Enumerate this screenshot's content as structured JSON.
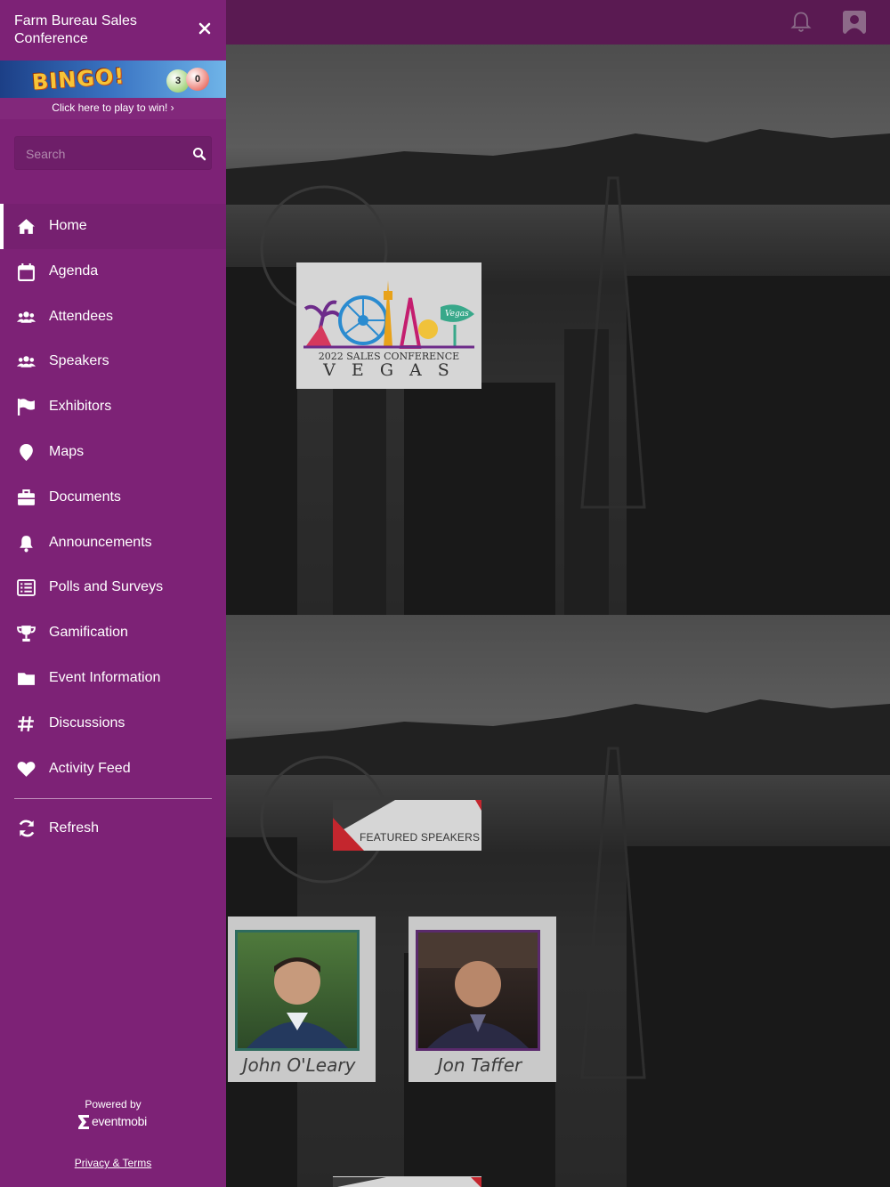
{
  "app": {
    "title": "Farm Bureau Sales Conference"
  },
  "banner": {
    "bingo_text": "BINGO!",
    "cta": "Click here to play to win! ›",
    "balls": [
      "3",
      "0"
    ]
  },
  "search": {
    "placeholder": "Search"
  },
  "nav": {
    "items": [
      {
        "label": "Home",
        "icon": "home-icon",
        "active": true
      },
      {
        "label": "Agenda",
        "icon": "calendar-icon"
      },
      {
        "label": "Attendees",
        "icon": "users-icon"
      },
      {
        "label": "Speakers",
        "icon": "users-icon"
      },
      {
        "label": "Exhibitors",
        "icon": "flag-icon"
      },
      {
        "label": "Maps",
        "icon": "map-pin-icon"
      },
      {
        "label": "Documents",
        "icon": "briefcase-icon"
      },
      {
        "label": "Announcements",
        "icon": "bell-icon"
      },
      {
        "label": "Polls and Surveys",
        "icon": "list-icon"
      },
      {
        "label": "Gamification",
        "icon": "trophy-icon"
      },
      {
        "label": "Event Information",
        "icon": "folder-icon"
      },
      {
        "label": "Discussions",
        "icon": "hashtag-icon"
      },
      {
        "label": "Activity Feed",
        "icon": "heart-icon"
      }
    ],
    "refresh": "Refresh"
  },
  "footer": {
    "powered_by": "Powered by",
    "brand": "eventmobi",
    "privacy": "Privacy & Terms"
  },
  "main": {
    "logo": {
      "line1": "2022 SALES CONFERENCE",
      "line2": "V E G A S",
      "sign_text": "Vegas"
    },
    "featured_label": "FEATURED SPEAKERS",
    "speakers": [
      {
        "name": "John O'Leary"
      },
      {
        "name": "Jon Taffer"
      }
    ]
  },
  "colors": {
    "drawer": "#7d2276",
    "topbar": "#5a1a52",
    "accent_white": "#ffffff"
  }
}
